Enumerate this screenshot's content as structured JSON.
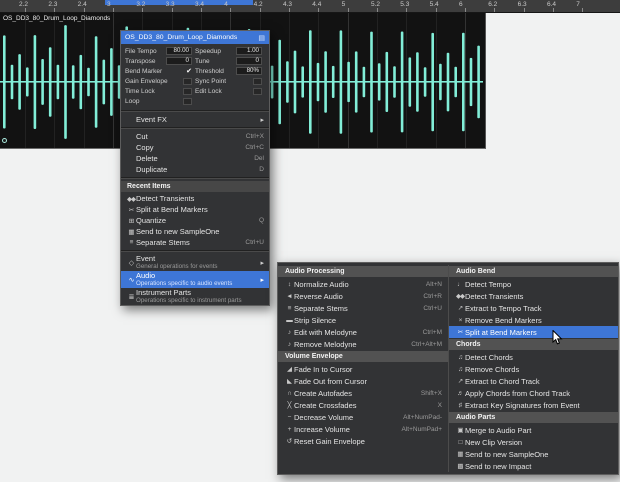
{
  "colors": {
    "accent": "#3e76d6",
    "waveform": "#82eed8",
    "menu_bg": "#323335",
    "lane_bg": "#121212"
  },
  "ruler": {
    "labels": [
      "2.2",
      "2.3",
      "2.4",
      "3",
      "3.2",
      "3.3",
      "3.4",
      "4",
      "4.2",
      "4.3",
      "4.4",
      "5",
      "5.2",
      "5.3",
      "5.4",
      "6",
      "6.2",
      "6.3",
      "6.4",
      "7"
    ]
  },
  "clip": {
    "name": "OS_DD3_80_Drum_Loop_Diamonds"
  },
  "context_menu": {
    "title": "OS_DD3_80_Drum_Loop_Diamonds",
    "properties": [
      [
        {
          "label": "File Tempo",
          "value": "80.00"
        },
        {
          "label": "Speedup",
          "value": "1.00"
        }
      ],
      [
        {
          "label": "Transpose",
          "value": "0"
        },
        {
          "label": "Tune",
          "value": "0"
        }
      ],
      [
        {
          "label": "Bend Marker",
          "check": true
        },
        {
          "label": "Threshold",
          "value": "80%"
        }
      ],
      [
        {
          "label": "Gain Envelope",
          "box": true
        },
        {
          "label": "Sync Point",
          "box": true
        }
      ],
      [
        {
          "label": "Time Lock",
          "box": true
        },
        {
          "label": "Edit Lock",
          "box": true
        }
      ],
      [
        {
          "label": "Loop",
          "box": true
        }
      ]
    ],
    "items": [
      {
        "type": "sep"
      },
      {
        "label": "Event FX",
        "submenu": true
      },
      {
        "type": "sep"
      },
      {
        "label": "Cut",
        "shortcut": "Ctrl+X"
      },
      {
        "label": "Copy",
        "shortcut": "Ctrl+C"
      },
      {
        "label": "Delete",
        "shortcut": "Del"
      },
      {
        "label": "Duplicate",
        "shortcut": "D"
      },
      {
        "type": "sep"
      },
      {
        "type": "header",
        "label": "Recent Items"
      },
      {
        "icon": "transients",
        "label": "Detect Transients"
      },
      {
        "icon": "split",
        "label": "Split at Bend Markers"
      },
      {
        "icon": "quantize",
        "label": "Quantize",
        "shortcut": "Q"
      },
      {
        "icon": "sampleone",
        "label": "Send to new SampleOne"
      },
      {
        "icon": "stems",
        "label": "Separate Stems",
        "shortcut": "Ctrl+U"
      },
      {
        "type": "sep"
      },
      {
        "icon": "event",
        "label": "Event",
        "sub": "General operations for events",
        "submenu": true
      },
      {
        "icon": "audio",
        "label": "Audio",
        "sub": "Operations specific to audio events",
        "submenu": true,
        "highlight": true
      },
      {
        "icon": "instrument",
        "label": "Instrument Parts",
        "sub": "Operations specific to instrument parts"
      }
    ]
  },
  "audio_submenu": {
    "columns": [
      {
        "sections": [
          {
            "header": "Audio Processing",
            "items": [
              {
                "icon": "normalize",
                "label": "Normalize Audio",
                "shortcut": "Alt+N"
              },
              {
                "icon": "reverse",
                "label": "Reverse Audio",
                "shortcut": "Ctrl+R"
              },
              {
                "icon": "stems",
                "label": "Separate Stems",
                "shortcut": "Ctrl+U"
              },
              {
                "icon": "strip",
                "label": "Strip Silence"
              },
              {
                "icon": "melodyne",
                "label": "Edit with Melodyne",
                "shortcut": "Ctrl+M"
              },
              {
                "icon": "melodyne-remove",
                "label": "Remove Melodyne",
                "shortcut": "Ctrl+Alt+M"
              }
            ]
          },
          {
            "header": "Volume Envelope",
            "items": [
              {
                "icon": "fade-in",
                "label": "Fade In to Cursor"
              },
              {
                "icon": "fade-out",
                "label": "Fade Out from Cursor"
              },
              {
                "icon": "autofade",
                "label": "Create Autofades",
                "shortcut": "Shift+X"
              },
              {
                "icon": "crossfade",
                "label": "Create Crossfades",
                "shortcut": "X"
              },
              {
                "icon": "vol-down",
                "label": "Decrease Volume",
                "shortcut": "Alt+NumPad-"
              },
              {
                "icon": "vol-up",
                "label": "Increase Volume",
                "shortcut": "Alt+NumPad+"
              },
              {
                "icon": "reset-gain",
                "label": "Reset Gain Envelope"
              }
            ]
          }
        ]
      },
      {
        "sections": [
          {
            "header": "Audio Bend",
            "items": [
              {
                "icon": "tempo",
                "label": "Detect Tempo"
              },
              {
                "icon": "transients",
                "label": "Detect Transients"
              },
              {
                "icon": "extract-tempo",
                "label": "Extract to Tempo Track"
              },
              {
                "icon": "remove-bend",
                "label": "Remove Bend Markers"
              },
              {
                "icon": "split",
                "label": "Split at Bend Markers",
                "highlight": true
              }
            ]
          },
          {
            "header": "Chords",
            "items": [
              {
                "icon": "detect-chords",
                "label": "Detect Chords"
              },
              {
                "icon": "remove-chords",
                "label": "Remove Chords"
              },
              {
                "icon": "extract-chord",
                "label": "Extract to Chord Track"
              },
              {
                "icon": "apply-chords",
                "label": "Apply Chords from Chord Track"
              },
              {
                "icon": "key-sig",
                "label": "Extract Key Signatures from Event"
              }
            ]
          },
          {
            "header": "Audio Parts",
            "items": [
              {
                "icon": "merge",
                "label": "Merge to Audio Part"
              },
              {
                "icon": "clip",
                "label": "New Clip Version"
              },
              {
                "icon": "sampleone",
                "label": "Send to new SampleOne"
              },
              {
                "icon": "impact",
                "label": "Send to new Impact"
              }
            ]
          }
        ]
      }
    ]
  }
}
